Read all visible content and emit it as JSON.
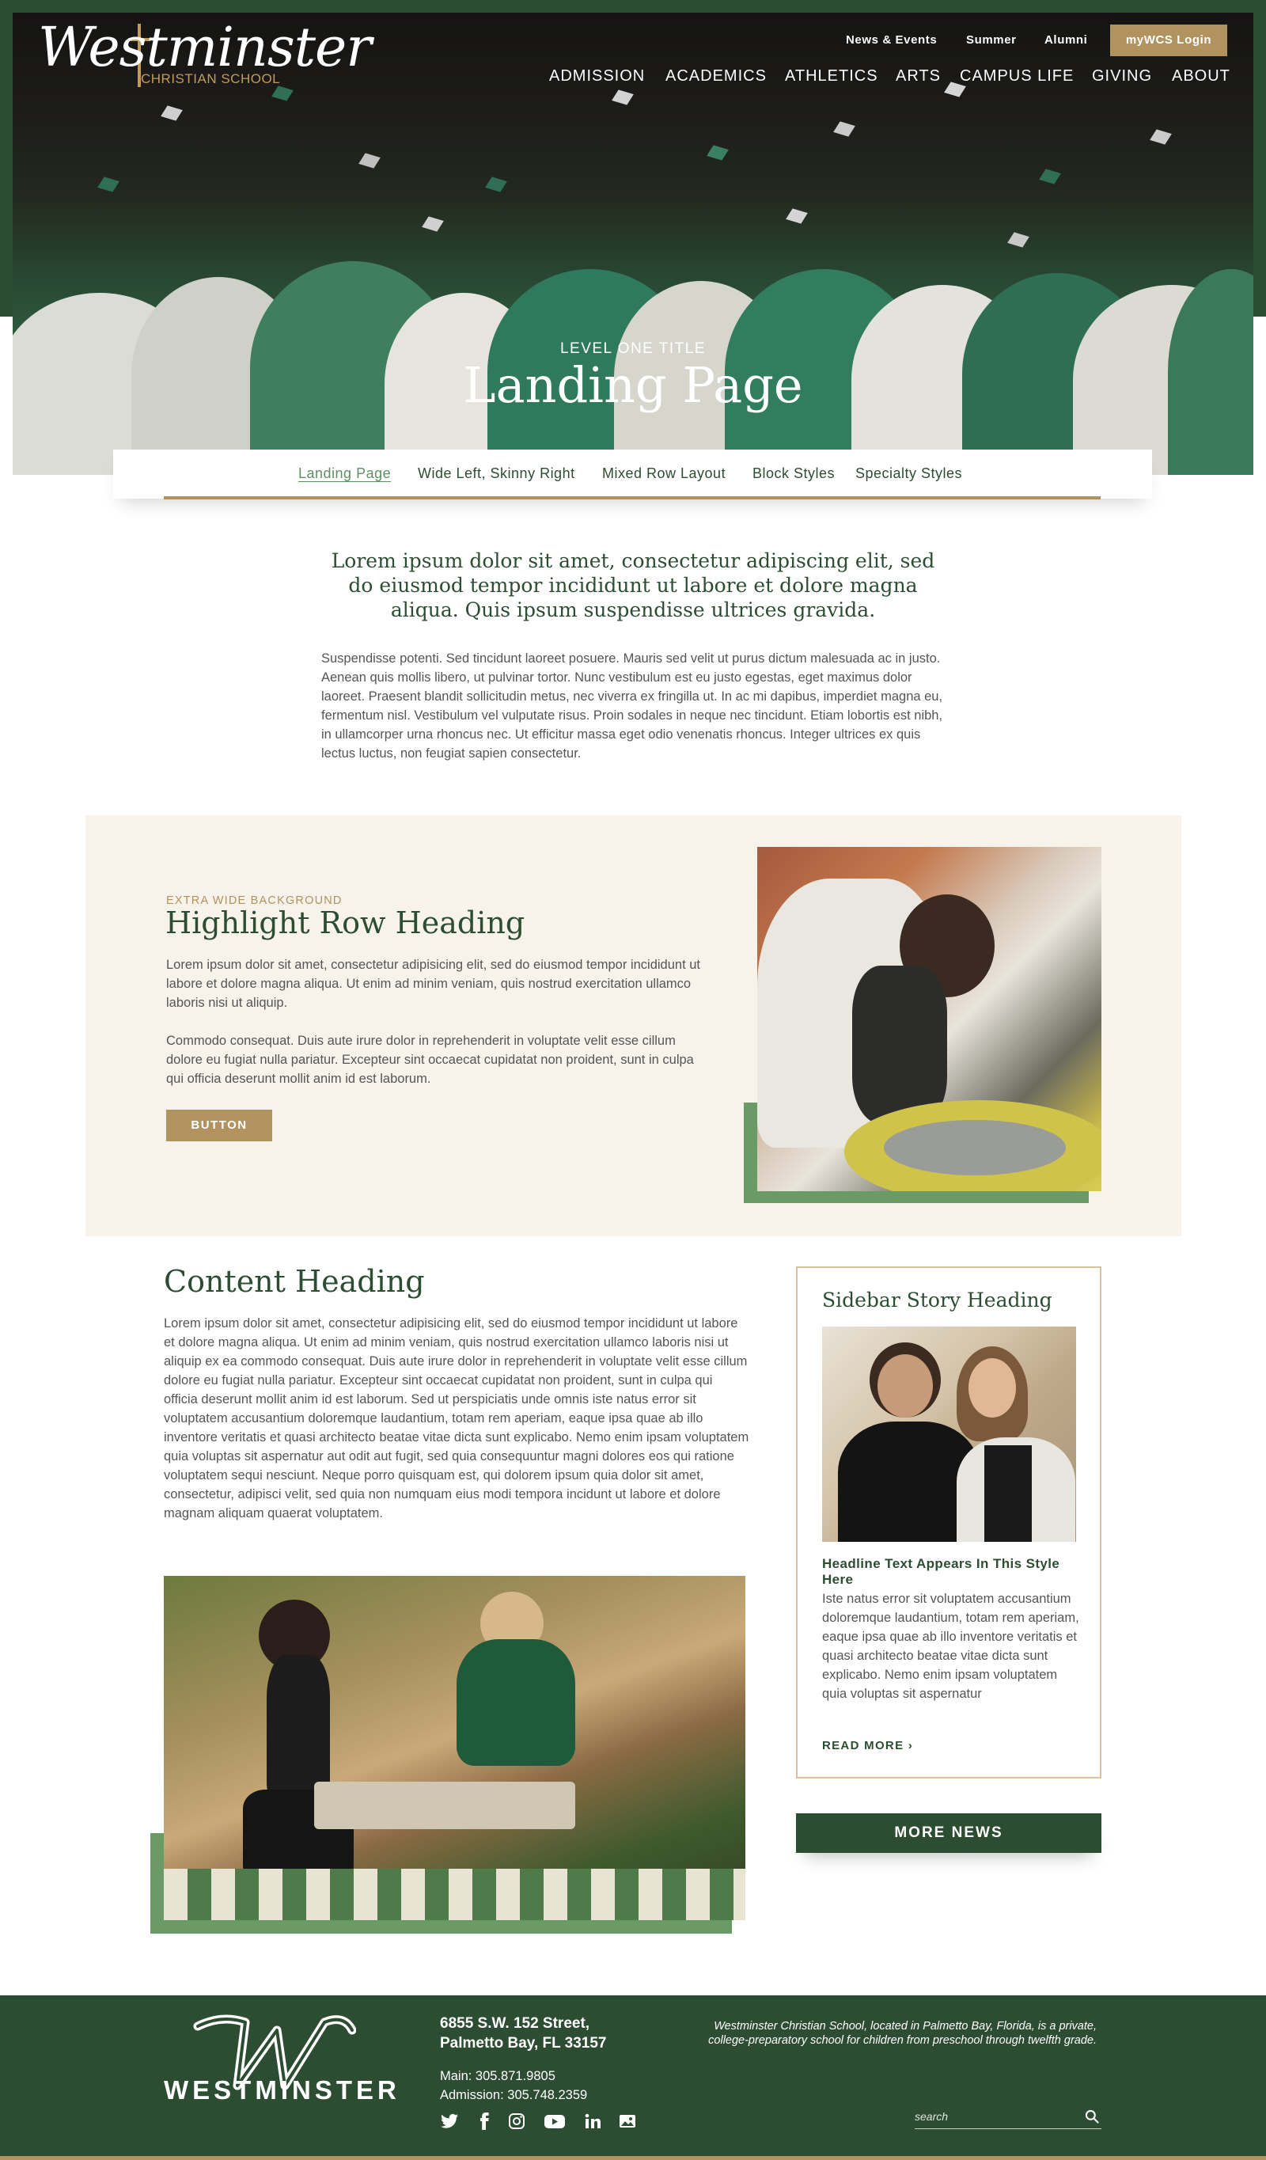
{
  "logo": {
    "wordmark": "Westminster",
    "subline": "CHRISTIAN SCHOOL"
  },
  "utility_nav": [
    "News & Events",
    "Summer",
    "Alumni"
  ],
  "login_label": "myWCS Login",
  "main_nav": [
    "ADMISSION",
    "ACADEMICS",
    "ATHLETICS",
    "ARTS",
    "CAMPUS LIFE",
    "GIVING",
    "ABOUT"
  ],
  "hero": {
    "kicker": "LEVEL ONE TITLE",
    "title": "Landing Page"
  },
  "subnav": [
    "Landing Page",
    "Wide Left, Skinny Right",
    "Mixed Row Layout",
    "Block Styles",
    "Specialty Styles"
  ],
  "intro": {
    "lead": "Lorem ipsum dolor sit amet, consectetur adipiscing elit, sed do eiusmod tempor incididunt ut labore et dolore magna aliqua. Quis ipsum suspendisse ultrices gravida.",
    "body": "Suspendisse potenti. Sed tincidunt laoreet posuere. Mauris sed velit ut purus dictum malesuada ac in justo. Aenean quis mollis libero, ut pulvinar tortor. Nunc vestibulum est eu justo egestas, eget maximus dolor laoreet. Praesent blandit sollicitudin metus, nec viverra ex fringilla ut. In ac mi dapibus, imperdiet magna eu, fermentum nisl. Vestibulum vel vulputate risus. Proin sodales in neque nec tincidunt. Etiam lobortis est nibh, in ullamcorper urna rhoncus nec. Ut efficitur massa eget odio venenatis rhoncus. Integer ultrices ex quis lectus luctus, non feugiat sapien consectetur."
  },
  "highlight": {
    "kicker": "EXTRA WIDE BACKGROUND",
    "title": "Highlight Row Heading",
    "p1": "Lorem ipsum dolor sit amet, consectetur adipisicing elit, sed do eiusmod tempor incididunt ut labore et dolore magna aliqua. Ut enim ad minim veniam, quis nostrud exercitation ullamco laboris nisi ut aliquip.",
    "p2": "Commodo consequat. Duis aute irure dolor in reprehenderit in voluptate velit esse cillum dolore eu fugiat nulla pariatur. Excepteur sint occaecat cupidatat non proident, sunt in culpa qui officia deserunt mollit anim id est laborum.",
    "button": "BUTTON"
  },
  "content": {
    "title": "Content Heading",
    "body": "Lorem ipsum dolor sit amet, consectetur adipisicing elit, sed do eiusmod tempor incididunt ut labore et dolore magna aliqua. Ut enim ad minim veniam, quis nostrud exercitation ullamco laboris nisi ut aliquip ex ea commodo consequat. Duis aute irure dolor in reprehenderit in voluptate velit esse cillum dolore eu fugiat nulla pariatur. Excepteur sint occaecat cupidatat non proident, sunt in culpa qui officia deserunt mollit anim id est laborum. Sed ut perspiciatis unde omnis iste natus error sit voluptatem accusantium doloremque laudantium, totam rem aperiam, eaque ipsa quae ab illo inventore veritatis et quasi architecto beatae vitae dicta sunt explicabo. Nemo enim ipsam voluptatem quia voluptas sit aspernatur aut odit aut fugit, sed quia consequuntur magni dolores eos qui ratione voluptatem sequi nesciunt. Neque porro quisquam est, qui dolorem ipsum quia dolor sit amet, consectetur, adipisci velit, sed quia non numquam eius modi tempora incidunt ut labore et dolore magnam aliquam quaerat voluptatem."
  },
  "sidebar": {
    "title": "Sidebar Story Heading",
    "headline": "Headline Text Appears In This Style Here",
    "body": "Iste natus error sit voluptatem accusantium doloremque laudantium, totam rem aperiam, eaque ipsa quae ab illo inventore veritatis et quasi architecto beatae vitae dicta sunt explicabo. Nemo enim ipsam voluptatem quia voluptas sit aspernatur",
    "read_more": "READ MORE",
    "more_news": "MORE NEWS"
  },
  "footer": {
    "wordmark": "WESTMINSTER",
    "address_1": "6855 S.W. 152 Street,",
    "address_2": "Palmetto Bay, FL 33157",
    "main_phone": "Main: 305.871.9805",
    "admission_phone": "Admission: 305.748.2359",
    "blurb": "Westminster Christian School, located in Palmetto Bay, Florida, is a private, college-preparatory school for children from preschool through twelfth grade.",
    "search_placeholder": "search",
    "social": [
      "twitter-icon",
      "facebook-icon",
      "instagram-icon",
      "youtube-icon",
      "linkedin-icon",
      "gallery-icon"
    ]
  },
  "colors": {
    "brand_green": "#2d4d33",
    "accent_gold": "#b0935e",
    "soft_green": "#6a9a66",
    "cream": "#f7f2ea"
  }
}
